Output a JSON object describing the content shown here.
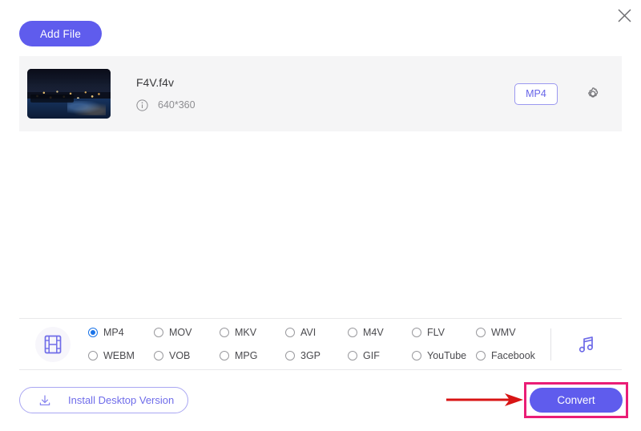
{
  "window": {
    "close_label": "×",
    "close_icon": "close-icon",
    "background": "#ffffff"
  },
  "toolbar": {
    "add_file_label": "Add File",
    "add_file_color": "#5f5ced"
  },
  "file_list": {
    "panel_background": "#f5f5f6",
    "items": [
      {
        "name": "F4V.f4v",
        "info_icon": "info-circle-icon",
        "dimensions": "640*360",
        "output_format": "MP4",
        "settings_icon": "gear-icon",
        "thumbnail_alt": "night aerial cityscape harbor"
      }
    ]
  },
  "format_selector": {
    "video_icon": "film-strip-icon",
    "audio_icon": "music-note-icon",
    "selected": "MP4",
    "accent_selected": "#1a73e8",
    "options": [
      {
        "label": "MP4",
        "selected": true
      },
      {
        "label": "MOV",
        "selected": false
      },
      {
        "label": "MKV",
        "selected": false
      },
      {
        "label": "AVI",
        "selected": false
      },
      {
        "label": "M4V",
        "selected": false
      },
      {
        "label": "FLV",
        "selected": false
      },
      {
        "label": "WMV",
        "selected": false
      },
      {
        "label": "WEBM",
        "selected": false
      },
      {
        "label": "VOB",
        "selected": false
      },
      {
        "label": "MPG",
        "selected": false
      },
      {
        "label": "3GP",
        "selected": false
      },
      {
        "label": "GIF",
        "selected": false
      },
      {
        "label": "YouTube",
        "selected": false
      },
      {
        "label": "Facebook",
        "selected": false
      }
    ]
  },
  "footer": {
    "install_label": "Install Desktop Version",
    "install_icon": "download-icon",
    "install_color": "#6f6cea",
    "convert_label": "Convert",
    "convert_color": "#5f5ced"
  },
  "annotations": {
    "highlight_box_color": "#ea1d76",
    "arrow_color": "#d81414",
    "arrow_direction": "right",
    "target": "Convert"
  }
}
